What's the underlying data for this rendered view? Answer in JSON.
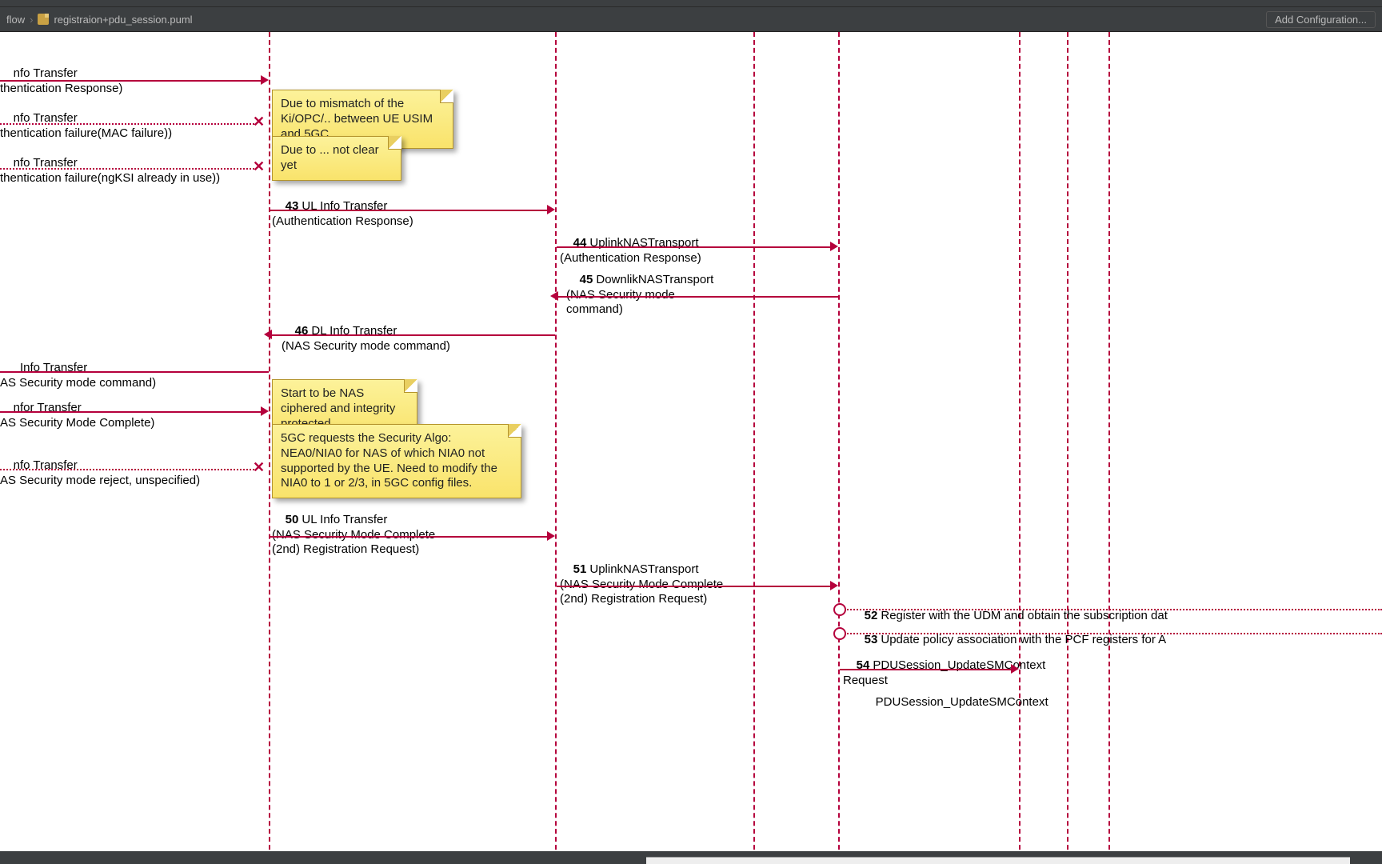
{
  "breadcrumbs": {
    "folder": "flow",
    "file": "registraion+pdu_session.puml"
  },
  "toolbar": {
    "add_config": "Add Configuration..."
  },
  "lifelines_x": [
    336,
    694,
    942,
    1048,
    1274,
    1334,
    1386
  ],
  "notes": {
    "n1": "Due to mismatch of the Ki/OPC/..\nbetween UE USIM and 5GC",
    "n2": "Due to ... not clear yet",
    "n3": "Start to be NAS ciphered\nand integrity protected",
    "n4": "5GC requests the Security Algo: NEA0/NIA0\nfor NAS of which NIA0 not supported by the UE.\nNeed to modify the NIA0 to 1 or 2/3, in\n5GC config files."
  },
  "msgs": {
    "m1": {
      "num": "",
      "text": "nfo Transfer\nthentication Response)"
    },
    "m2": {
      "num": "",
      "text": "nfo Transfer\nthentication failure(MAC failure))"
    },
    "m3": {
      "num": "",
      "text": "nfo Transfer\nthentication failure(ngKSI already in use))"
    },
    "m43": {
      "num": "43",
      "text": "UL Info Transfer\n(Authentication Response)"
    },
    "m44": {
      "num": "44",
      "text": "UplinkNASTransport\n(Authentication Response)"
    },
    "m45": {
      "num": "45",
      "text": "DownlikNASTransport\n(NAS Security mode\ncommand)"
    },
    "m46": {
      "num": "46",
      "text": "DL Info Transfer\n(NAS Security mode command)"
    },
    "m47": {
      "num": "",
      "text": "  Info Transfer\nAS Security mode command)"
    },
    "m48": {
      "num": "",
      "text": "nfor Transfer\nAS Security Mode Complete)"
    },
    "m49": {
      "num": "",
      "text": "nfo Transfer\nAS Security mode reject, unspecified)"
    },
    "m50": {
      "num": "50",
      "text": "UL Info Transfer\n(NAS Security Mode Complete\n(2nd) Registration Request)"
    },
    "m51": {
      "num": "51",
      "text": "UplinkNASTransport\n(NAS Security Mode Complete\n(2nd) Registration Request)"
    },
    "m52": {
      "num": "52",
      "text": "Register with the UDM and obtain the subscription dat"
    },
    "m53": {
      "num": "53",
      "text": "Update policy association with the PCF registers for A"
    },
    "m54": {
      "num": "54",
      "text": "PDUSession_UpdateSMContext\nRequest"
    },
    "m55": {
      "num": "",
      "text": "PDUSession_UpdateSMContext"
    }
  }
}
